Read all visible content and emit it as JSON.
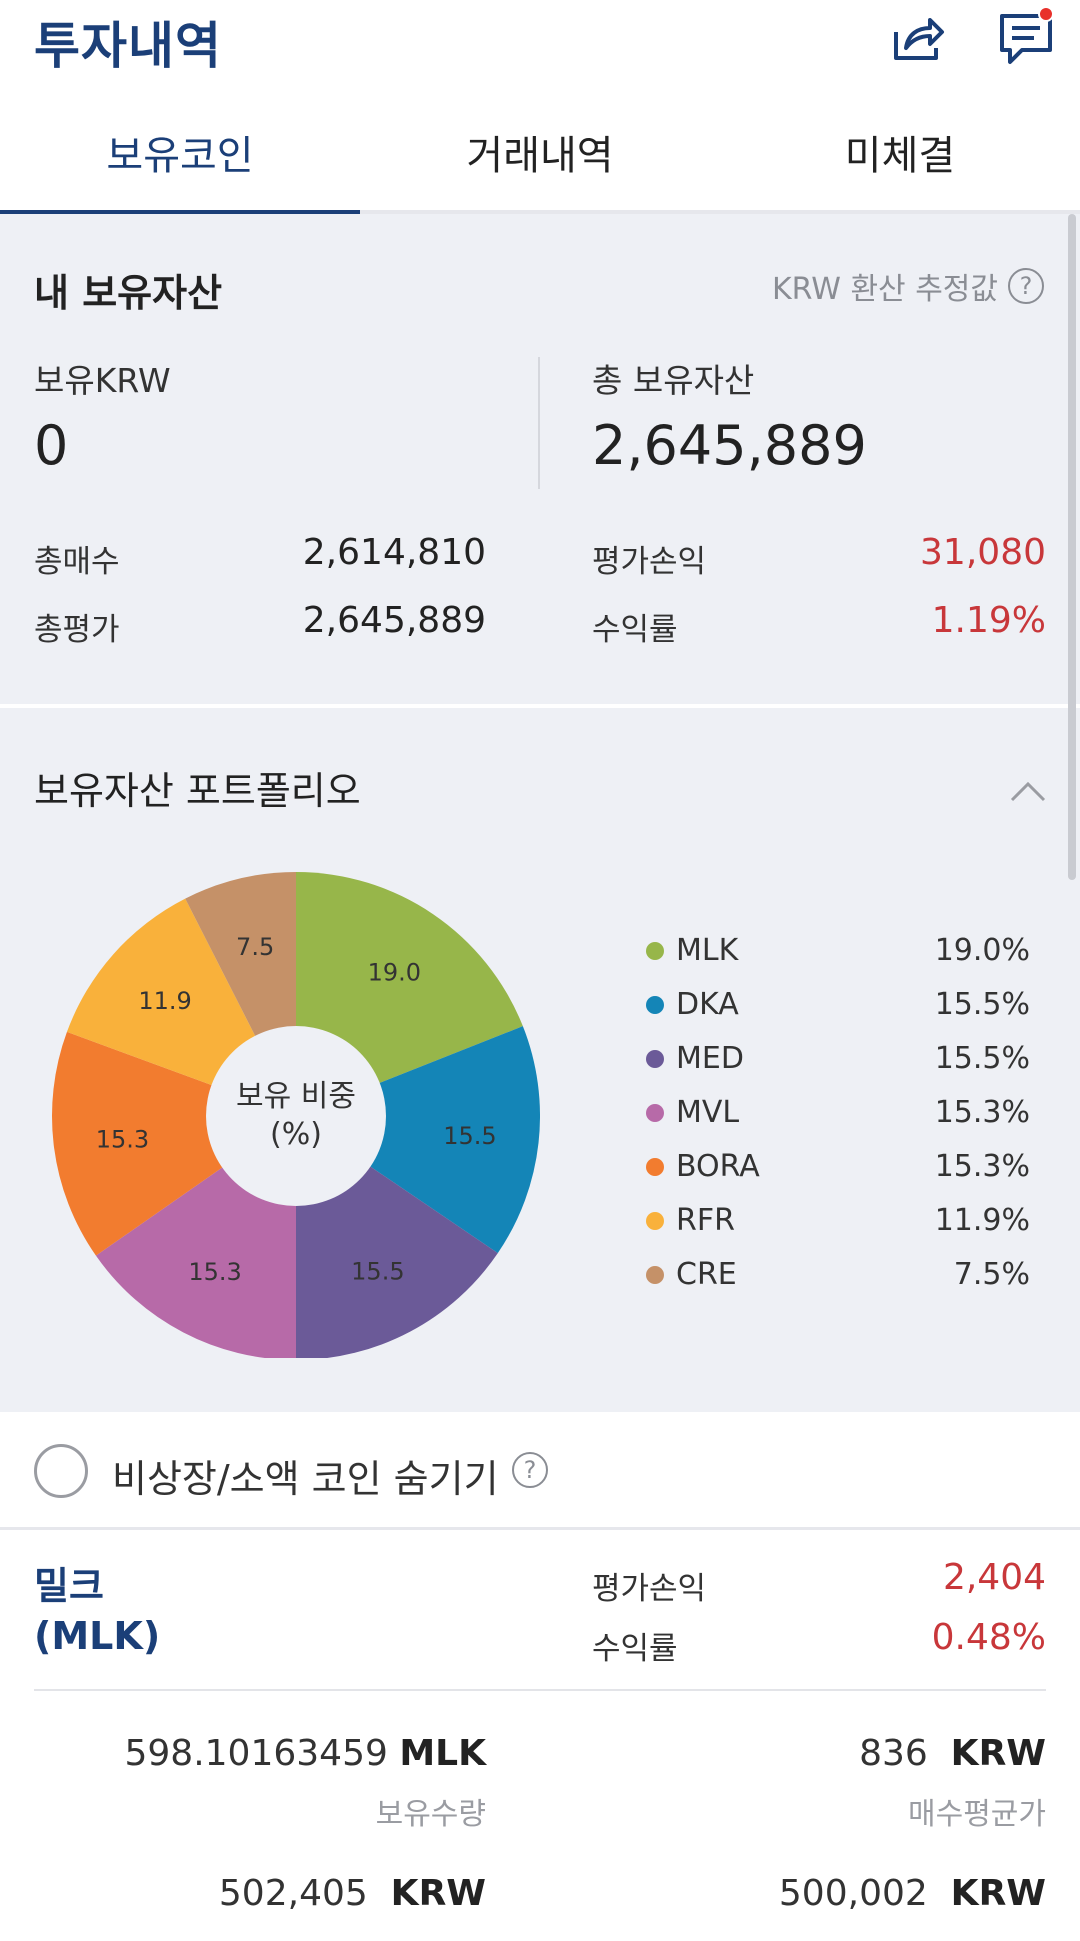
{
  "header": {
    "title": "투자내역",
    "icons": [
      "share-icon",
      "message-icon"
    ],
    "notification_color": "#e8312b"
  },
  "tabs": [
    {
      "label": "보유코인",
      "active": true
    },
    {
      "label": "거래내역",
      "active": false
    },
    {
      "label": "미체결",
      "active": false
    }
  ],
  "summary": {
    "title": "내 보유자산",
    "krw_note": "KRW 환산 추정값",
    "help_glyph": "?",
    "krw_label": "보유KRW",
    "krw_value": "0",
    "total_label": "총 보유자산",
    "total_value": "2,645,889",
    "buy_label": "총매수",
    "buy_value": "2,614,810",
    "eval_label": "총평가",
    "eval_value": "2,645,889",
    "pnl_label": "평가손익",
    "pnl_value": "31,080",
    "rate_label": "수익률",
    "rate_value": "1.19%"
  },
  "portfolio": {
    "title": "보유자산 포트폴리오",
    "center_label_1": "보유 비중",
    "center_label_2": "(%)"
  },
  "chart_data": {
    "type": "pie",
    "categories": [
      "MLK",
      "DKA",
      "MED",
      "MVL",
      "BORA",
      "RFR",
      "CRE"
    ],
    "values": [
      19.0,
      15.5,
      15.5,
      15.3,
      15.3,
      11.9,
      7.5
    ],
    "slice_labels": [
      "19.0",
      "15.5",
      "15.5",
      "15.3",
      "15.3",
      "11.9",
      "7.5"
    ],
    "legend_pct": [
      "19.0%",
      "15.5%",
      "15.5%",
      "15.3%",
      "15.3%",
      "11.9%",
      "7.5%"
    ],
    "colors": [
      "#97b64a",
      "#1485b7",
      "#6b5a98",
      "#b76aa8",
      "#f27c2f",
      "#f9b13b",
      "#c59168"
    ],
    "legend_position": "right",
    "donut": true
  },
  "hide_option": {
    "label": "비상장/소액 코인 숨기기",
    "checked": false,
    "help_glyph": "?"
  },
  "coin": {
    "name_line1": "밀크",
    "name_line2": "(MLK)",
    "pnl_label": "평가손익",
    "pnl_value": "2,404",
    "rate_label": "수익률",
    "rate_value": "0.48%",
    "qty_value": "598.10163459",
    "qty_unit": "MLK",
    "qty_label": "보유수량",
    "avg_value": "836",
    "avg_unit": "KRW",
    "avg_label": "매수평균가",
    "eval_value": "502,405",
    "eval_unit": "KRW",
    "buy_value": "500,002",
    "buy_unit": "KRW"
  }
}
